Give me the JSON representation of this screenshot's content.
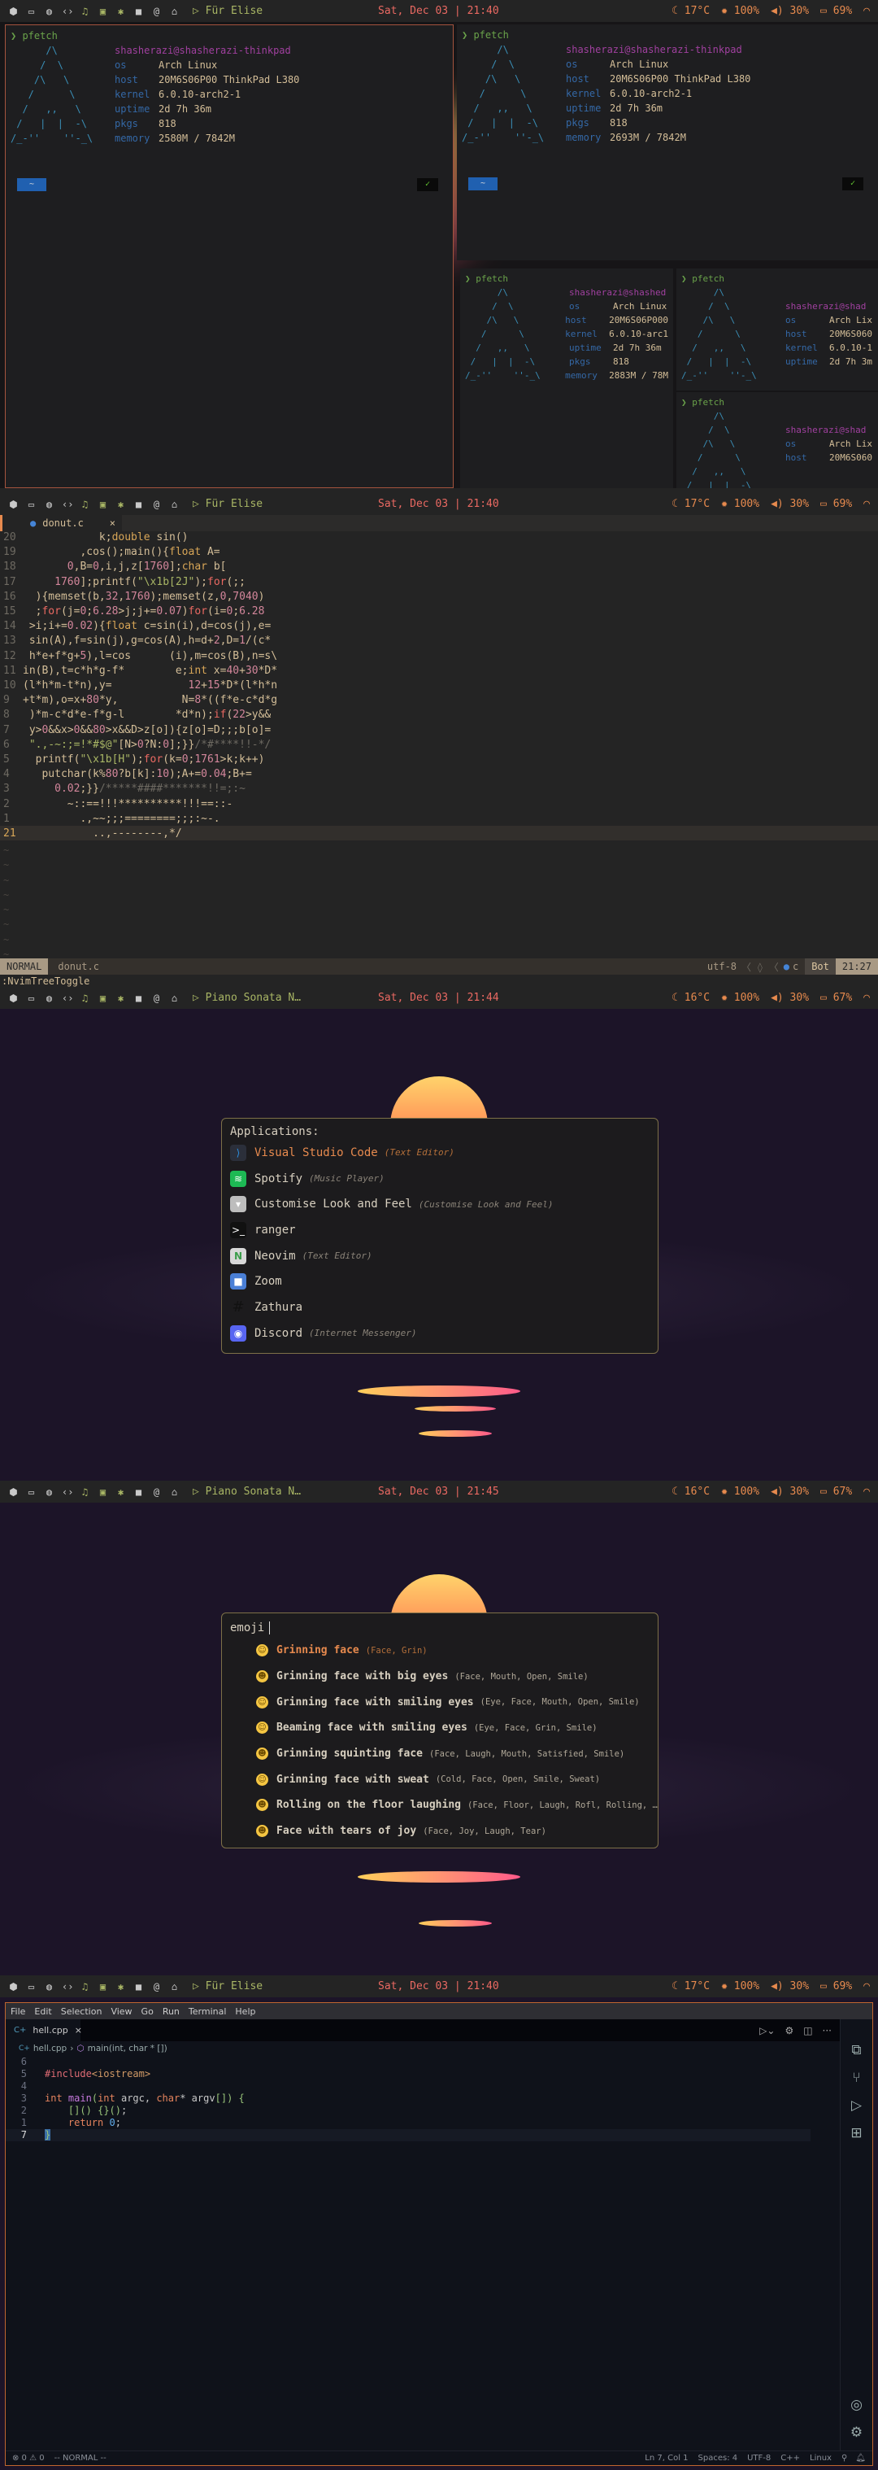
{
  "bars": [
    {
      "media": "Für Elise",
      "clock": "Sat, Dec 03 | 21:40",
      "temp": "17°C",
      "brightness": "100%",
      "volume": "30%",
      "battery": "69%"
    },
    {
      "media": "Für Elise",
      "clock": "Sat, Dec 03 | 21:40",
      "temp": "17°C",
      "brightness": "100%",
      "volume": "30%",
      "battery": "69%"
    },
    {
      "media": "Piano Sonata N…",
      "clock": "Sat, Dec 03 | 21:44",
      "temp": "16°C",
      "brightness": "100%",
      "volume": "30%",
      "battery": "67%"
    },
    {
      "media": "Piano Sonata N…",
      "clock": "Sat, Dec 03 | 21:45",
      "temp": "16°C",
      "brightness": "100%",
      "volume": "30%",
      "battery": "67%"
    },
    {
      "media": "Für Elise",
      "clock": "Sat, Dec 03 | 21:40",
      "temp": "17°C",
      "brightness": "100%",
      "volume": "30%",
      "battery": "69%"
    }
  ],
  "workspace_icons": [
    "cube-icon",
    "folder-icon",
    "globe-icon",
    "code-icon",
    "music-icon",
    "chat-icon",
    "settings-icon",
    "video-icon",
    "at-icon",
    "shapes-icon"
  ],
  "pfetch": {
    "command": "pfetch",
    "ascii_art": [
      "      /\\",
      "     /  \\",
      "    /\\   \\",
      "   /      \\",
      "  /   ,,   \\",
      " /   |  |  -\\",
      "/_-''    ''-_\\"
    ],
    "terminals": [
      {
        "user": "shasherazi",
        "host": "shasherazi-thinkpad",
        "rows": [
          [
            "os",
            "Arch Linux"
          ],
          [
            "host",
            "20M6S06P00 ThinkPad L380"
          ],
          [
            "kernel",
            "6.0.10-arch2-1"
          ],
          [
            "uptime",
            "2d 7h 36m"
          ],
          [
            "pkgs",
            "818"
          ],
          [
            "memory",
            "2580M / 7842M"
          ]
        ]
      },
      {
        "user": "shasherazi",
        "host": "shasherazi-thinkpad",
        "rows": [
          [
            "os",
            "Arch Linux"
          ],
          [
            "host",
            "20M6S06P00 ThinkPad L380"
          ],
          [
            "kernel",
            "6.0.10-arch2-1"
          ],
          [
            "uptime",
            "2d 7h 36m"
          ],
          [
            "pkgs",
            "818"
          ],
          [
            "memory",
            "2693M / 7842M"
          ]
        ]
      },
      {
        "user": "shasherazi",
        "host": "shashed",
        "rows": [
          [
            "os",
            "Arch Linux"
          ],
          [
            "host",
            "20M6S06P000"
          ],
          [
            "kernel",
            "6.0.10-arc1"
          ],
          [
            "uptime",
            "2d 7h 36m"
          ],
          [
            "pkgs",
            "818"
          ],
          [
            "memory",
            "2883M / 78M"
          ]
        ]
      },
      {
        "user": "shasherazi",
        "host": "shad",
        "rows": [
          [
            "os",
            "Arch Lix"
          ],
          [
            "host",
            "20M6S060"
          ],
          [
            "kernel",
            "6.0.10-1"
          ],
          [
            "uptime",
            "2d 7h 3m"
          ]
        ]
      },
      {
        "user": "shasherazi",
        "host": "shad",
        "rows": [
          [
            "os",
            "Arch Lix"
          ],
          [
            "host",
            "20M6S060"
          ]
        ]
      }
    ],
    "prompt_tag": "~",
    "prompt_check": "✓"
  },
  "nvim": {
    "tab": "donut.c",
    "close": "×",
    "lines": [
      [
        "20",
        "            k;double sin()"
      ],
      [
        "19",
        "         ,cos();main(){float A="
      ],
      [
        "18",
        "       0,B=0,i,j,z[1760];char b["
      ],
      [
        "17",
        "     1760];printf(\"\\x1b[2J\");for(;;"
      ],
      [
        "16",
        "  ){memset(b,32,1760);memset(z,0,7040)"
      ],
      [
        "15",
        "  ;for(j=0;6.28>j;j+=0.07)for(i=0;6.28"
      ],
      [
        "14",
        " >i;i+=0.02){float c=sin(i),d=cos(j),e="
      ],
      [
        "13",
        " sin(A),f=sin(j),g=cos(A),h=d+2,D=1/(c*"
      ],
      [
        "12",
        " h*e+f*g+5),l=cos      (i),m=cos(B),n=s\\"
      ],
      [
        "11",
        "in(B),t=c*h*g-f*        e;int x=40+30*D*"
      ],
      [
        "10",
        "(l*h*m-t*n),y=            12+15*D*(l*h*n"
      ],
      [
        "9",
        "+t*m),o=x+80*y,          N=8*((f*e-c*d*g"
      ],
      [
        "8",
        " )*m-c*d*e-f*g-l        *d*n);if(22>y&&"
      ],
      [
        "7",
        " y>0&&x>0&&80>x&&D>z[o]){z[o]=D;;;b[o]="
      ],
      [
        "6",
        " \".,-~:;=!*#$@\"[N>0?N:0];}}/*#****!!-*/"
      ],
      [
        "5",
        "  printf(\"\\x1b[H\");for(k=0;1761>k;k++)"
      ],
      [
        "4",
        "   putchar(k%80?b[k]:10);A+=0.04;B+="
      ],
      [
        "3",
        "     0.02;}}/*****####*******!!=;:~"
      ],
      [
        "2",
        "       ~::==!!!**********!!!==::-"
      ],
      [
        "1",
        "         .,~~;;;========;;;:~-."
      ],
      [
        "21",
        "           ..,--------,*/"
      ]
    ],
    "mode": "NORMAL",
    "file": "donut.c",
    "encoding": "utf-8",
    "filetype": "c",
    "position": "Bot",
    "cursor": "21:27",
    "command": ":NvimTreeToggle"
  },
  "launcher": {
    "header": "Applications:",
    "items": [
      {
        "name": "Visual Studio Code",
        "desc": "(Text Editor)",
        "icon": "vscode-icon",
        "color": "#2b2f3a",
        "glyph": "⟩"
      },
      {
        "name": "Spotify",
        "desc": "(Music Player)",
        "icon": "spotify-icon",
        "color": "#1db954",
        "glyph": "≋"
      },
      {
        "name": "Customise Look and Feel",
        "desc": "(Customise Look and Feel)",
        "icon": "tuxedo-icon",
        "color": "#bdbdbd",
        "glyph": "▾"
      },
      {
        "name": "ranger",
        "desc": "",
        "icon": "terminal-icon",
        "color": "#111111",
        "glyph": ">_"
      },
      {
        "name": "Neovim",
        "desc": "(Text Editor)",
        "icon": "neovim-icon",
        "color": "#d8d8d8",
        "glyph": "N"
      },
      {
        "name": "Zoom",
        "desc": "",
        "icon": "zoom-icon",
        "color": "#4a7fd6",
        "glyph": "■"
      },
      {
        "name": "Zathura",
        "desc": "",
        "icon": "zathura-icon",
        "color": "transparent",
        "glyph": "#"
      },
      {
        "name": "Discord",
        "desc": "(Internet Messenger)",
        "icon": "discord-icon",
        "color": "#5865f2",
        "glyph": "◉"
      }
    ]
  },
  "emoji": {
    "query": "emoji",
    "items": [
      {
        "name": "Grinning face",
        "tags": "(Face, Grin)",
        "icon": "grinning-face-icon"
      },
      {
        "name": "Grinning face with big eyes",
        "tags": "(Face, Mouth, Open, Smile)",
        "icon": "big-eyes-face-icon"
      },
      {
        "name": "Grinning face with smiling eyes",
        "tags": "(Eye, Face, Mouth, Open, Smile)",
        "icon": "smiling-eyes-face-icon"
      },
      {
        "name": "Beaming face with smiling eyes",
        "tags": "(Eye, Face, Grin, Smile)",
        "icon": "beaming-face-icon"
      },
      {
        "name": "Grinning squinting face",
        "tags": "(Face, Laugh, Mouth, Satisfied, Smile)",
        "icon": "squinting-face-icon"
      },
      {
        "name": "Grinning face with sweat",
        "tags": "(Cold, Face, Open, Smile, Sweat)",
        "icon": "sweat-face-icon"
      },
      {
        "name": "Rolling on the floor laughing",
        "tags": "(Face, Floor, Laugh, Rofl, Rolling, …",
        "icon": "rofl-face-icon"
      },
      {
        "name": "Face with tears of joy",
        "tags": "(Face, Joy, Laugh, Tear)",
        "icon": "tears-of-joy-face-icon"
      }
    ]
  },
  "vscode": {
    "menu": [
      "File",
      "Edit",
      "Selection",
      "View",
      "Go",
      "Run",
      "Terminal",
      "Help"
    ],
    "tab": "hell.cpp",
    "breadcrumb_file": "hell.cpp",
    "breadcrumb_symbol": "main(int, char * [])",
    "lines": [
      [
        "6",
        ""
      ],
      [
        "5",
        "#include<iostream>"
      ],
      [
        "4",
        ""
      ],
      [
        "3",
        "int main(int argc, char* argv[]) {"
      ],
      [
        "2",
        "    []() {}();"
      ],
      [
        "1",
        "    return 0;"
      ],
      [
        "7",
        "}"
      ]
    ],
    "status_left": [
      "⊗ 0 ⚠ 0",
      "-- NORMAL --"
    ],
    "status_right": [
      "Ln 7, Col 1",
      "Spaces: 4",
      "UTF-8",
      "C++",
      "Linux"
    ]
  }
}
